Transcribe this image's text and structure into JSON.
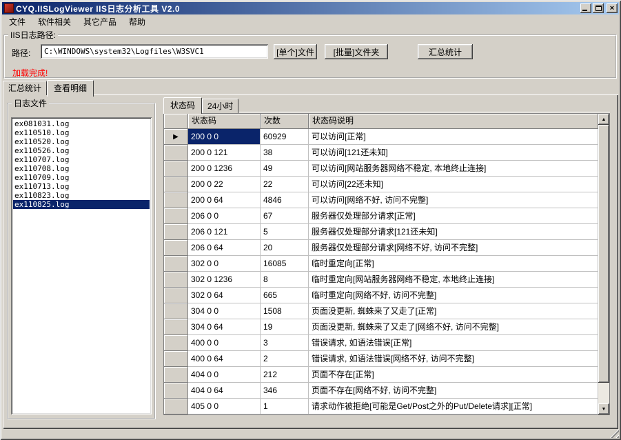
{
  "window": {
    "title": "CYQ.IISLogViewer IIS日志分析工具 V2.0"
  },
  "icons": {
    "close": "×",
    "scroll_up": "▲",
    "scroll_down": "▼",
    "selected_row_marker": "▶"
  },
  "menu": {
    "items": [
      "文件",
      "软件相关",
      "其它产品",
      "帮助"
    ]
  },
  "path_section": {
    "group_title": "IIS日志路径:",
    "path_label": "路径:",
    "path_value": "C:\\WINDOWS\\system32\\Logfiles\\W3SVC1",
    "buttons": {
      "single_file": "[单个]文件",
      "batch_folder": "[批量]文件夹",
      "summary": "汇总统计"
    },
    "status_message": "加载完成!"
  },
  "main_tabs": {
    "items": [
      {
        "label": "汇总统计",
        "active": false
      },
      {
        "label": "查看明细",
        "active": true
      }
    ]
  },
  "log_files": {
    "group_title": "日志文件",
    "selected_index": 9,
    "items": [
      "ex081031.log",
      "ex110510.log",
      "ex110520.log",
      "ex110526.log",
      "ex110707.log",
      "ex110708.log",
      "ex110709.log",
      "ex110713.log",
      "ex110823.log",
      "ex110825.log"
    ]
  },
  "detail_tabs": {
    "items": [
      {
        "label": "状态码",
        "active": true
      },
      {
        "label": "24小时",
        "active": false
      }
    ]
  },
  "status_grid": {
    "columns": [
      "状态码",
      "次数",
      "状态码说明"
    ],
    "selected_row_index": 0,
    "rows": [
      {
        "code": "200 0 0",
        "count": "60929",
        "desc": "可以访问[正常]"
      },
      {
        "code": "200 0 121",
        "count": "38",
        "desc": "可以访问[121还未知]"
      },
      {
        "code": "200 0 1236",
        "count": "49",
        "desc": "可以访问[网站服务器网络不稳定, 本地终止连接]"
      },
      {
        "code": "200 0 22",
        "count": "22",
        "desc": "可以访问[22还未知]"
      },
      {
        "code": "200 0 64",
        "count": "4846",
        "desc": "可以访问[网络不好, 访问不完整]"
      },
      {
        "code": "206 0 0",
        "count": "67",
        "desc": "服务器仅处理部分请求[正常]"
      },
      {
        "code": "206 0 121",
        "count": "5",
        "desc": "服务器仅处理部分请求[121还未知]"
      },
      {
        "code": "206 0 64",
        "count": "20",
        "desc": "服务器仅处理部分请求[网络不好, 访问不完整]"
      },
      {
        "code": "302 0 0",
        "count": "16085",
        "desc": "临时重定向[正常]"
      },
      {
        "code": "302 0 1236",
        "count": "8",
        "desc": "临时重定向[网站服务器网络不稳定, 本地终止连接]"
      },
      {
        "code": "302 0 64",
        "count": "665",
        "desc": "临时重定向[网络不好, 访问不完整]"
      },
      {
        "code": "304 0 0",
        "count": "1508",
        "desc": "页面没更新, 蜘蛛来了又走了[正常]"
      },
      {
        "code": "304 0 64",
        "count": "19",
        "desc": "页面没更新, 蜘蛛来了又走了[网络不好, 访问不完整]"
      },
      {
        "code": "400 0 0",
        "count": "3",
        "desc": "错误请求, 如语法错误[正常]"
      },
      {
        "code": "400 0 64",
        "count": "2",
        "desc": "错误请求, 如语法错误[网络不好, 访问不完整]"
      },
      {
        "code": "404 0 0",
        "count": "212",
        "desc": "页面不存在[正常]"
      },
      {
        "code": "404 0 64",
        "count": "346",
        "desc": "页面不存在[网络不好, 访问不完整]"
      },
      {
        "code": "405 0 0",
        "count": "1",
        "desc": "请求动作被拒绝[可能是Get/Post之外的Put/Delete请求][正常]"
      }
    ]
  },
  "colors": {
    "titlebar_gradient_start": "#0a246a",
    "titlebar_gradient_end": "#a6caf0",
    "selection": "#0a246a",
    "window_face": "#d4d0c8",
    "status_message": "#ff0000"
  }
}
